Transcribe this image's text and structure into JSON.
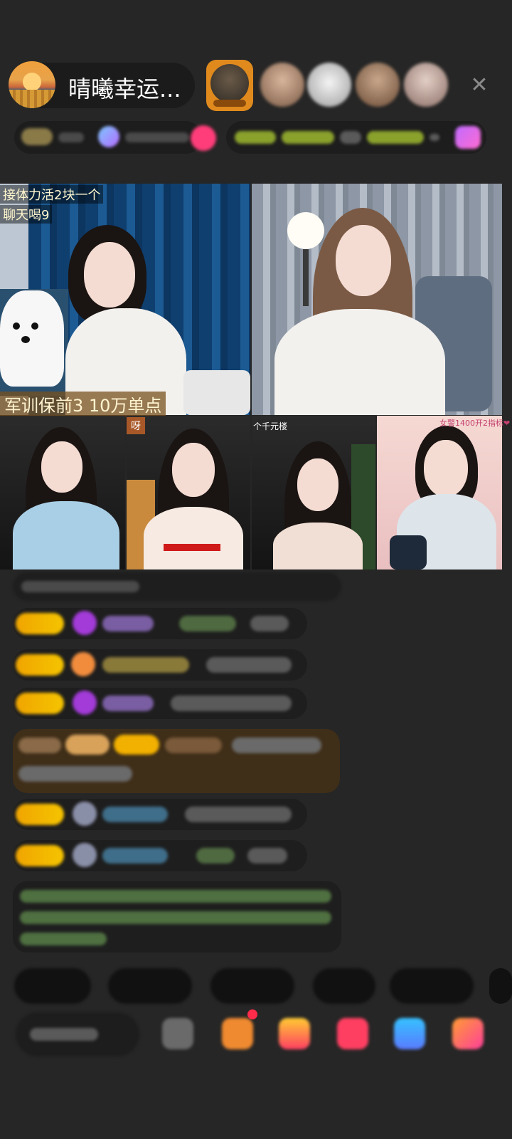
{
  "header": {
    "host_name": "晴曦幸运...",
    "close_label": "✕"
  },
  "video": {
    "top_left_line1": "接体力活2块一个",
    "top_left_line2": "聊天喝9",
    "top_left_banner": "军训保前3  10万单点",
    "small_tile_tag_1": "呀",
    "small_tile_tag_2": "个千元楼",
    "small_tile_tag_3": "女警1400开2指标❤"
  }
}
